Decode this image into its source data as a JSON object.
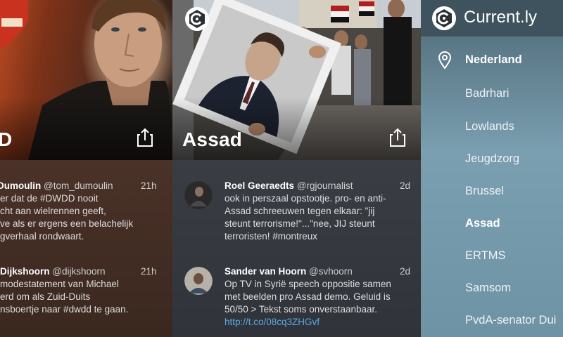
{
  "columns": [
    {
      "title": "D",
      "tweets": [
        {
          "name": "Dumoulin",
          "handle": "@tom_dumoulin",
          "time": "21h",
          "lines": [
            "er dat de #DWDD nooit",
            "cht aan wielrennen geeft,",
            "ve als er ergens een belachelijk",
            "gverhaal rondwaart."
          ]
        },
        {
          "name": "Dijkshoorn",
          "handle": "@dijkshoorn",
          "time": "21h",
          "lines": [
            "modestatement van Michael",
            "erd om als Zuid-Duits",
            "nsboertje naar #dwdd te gaan."
          ]
        }
      ]
    },
    {
      "title": "Assad",
      "tweets": [
        {
          "name": "Roel Geeraedts",
          "handle": "@rgjournalist",
          "time": "2d",
          "lines": [
            "ook in perszaal opstootje. pro- en anti-",
            "Assad schreeuwen tegen elkaar: \"jij",
            "steunt terrorisme!\"...\"nee, JIJ steunt",
            "terroristen! #montreux"
          ]
        },
        {
          "name": "Sander van Hoorn",
          "handle": "@svhoorn",
          "time": "2d",
          "lines": [
            "Op TV in Syrië speech oppositie samen",
            "met beelden pro Assad demo. Geluid is",
            "50/50 > Tekst soms onverstaanbaar."
          ],
          "link": "http://t.co/08cq3ZHGvf"
        }
      ]
    }
  ],
  "sidebar": {
    "title": "Current.ly",
    "items": [
      {
        "label": "Nederland",
        "active": true
      },
      {
        "label": "Badrhari",
        "active": false
      },
      {
        "label": "Lowlands",
        "active": false
      },
      {
        "label": "Jeugdzorg",
        "active": false
      },
      {
        "label": "Brussel",
        "active": false
      },
      {
        "label": "Assad",
        "active": true
      },
      {
        "label": "ERTMS",
        "active": false
      },
      {
        "label": "Samsom",
        "active": false
      },
      {
        "label": "PvdA-senator Dui",
        "active": false
      }
    ]
  },
  "icons": {
    "logo": "currently-logo-icon",
    "share": "share-icon",
    "location": "location-pin-icon"
  },
  "colors": {
    "link": "#5aa8e0",
    "sidebar_header": "#3e535e"
  }
}
